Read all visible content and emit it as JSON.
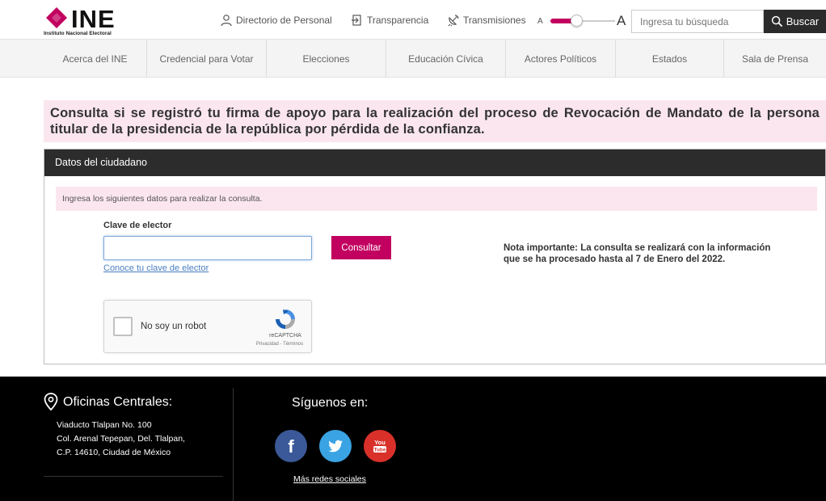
{
  "header": {
    "logo_word": "INE",
    "logo_sub": "Instituto Nacional Electoral",
    "links": [
      {
        "label": "Directorio de Personal",
        "icon": "user-icon"
      },
      {
        "label": "Transparencia",
        "icon": "transparency-icon"
      },
      {
        "label": "Transmisiones",
        "icon": "satellite-icon"
      }
    ],
    "font_size": {
      "small": "A",
      "large": "A",
      "level": 0.4
    },
    "search": {
      "placeholder": "Ingresa tu búsqueda",
      "button": "Buscar"
    }
  },
  "nav": {
    "items": [
      "Acerca del INE",
      "Credencial para Votar",
      "Elecciones",
      "Educación Cívica",
      "Actores Políticos",
      "Estados",
      "Sala de Prensa"
    ]
  },
  "main": {
    "title": "Consulta si se registró tu firma de apoyo para la realización del proceso de Revocación de Mandato de la persona titular de la presidencia de la república por pérdida de la confianza.",
    "panel_title": "Datos del ciudadano",
    "notice": "Ingresa los siguientes datos para realizar la consulta.",
    "field_label": "Clave de elector",
    "field_value": "",
    "submit": "Consultar",
    "help_link": "Conoce tu clave de elector",
    "note": "Nota importante: La consulta se realizará con la información que se ha procesado hasta al 7 de Enero del 2022.",
    "captcha": {
      "label": "No soy un robot",
      "brand": "reCAPTCHA",
      "links": "Privacidad - Términos"
    }
  },
  "footer": {
    "offices_title": "Oficinas Centrales:",
    "address": [
      "Viaducto Tlalpan No. 100",
      "Col. Arenal Tepepan, Del. Tlalpan,",
      "C.P. 14610, Ciudad de México"
    ],
    "follow_title": "Síguenos en:",
    "social": [
      {
        "name": "facebook-icon",
        "glyph": "f"
      },
      {
        "name": "twitter-icon",
        "glyph": ""
      },
      {
        "name": "youtube-icon",
        "glyph": "You Tube"
      }
    ],
    "more_social": "Más redes sociales"
  },
  "colors": {
    "accent": "#c2005f",
    "pink_bg": "#fbe6ef",
    "dark": "#2c2c2c",
    "footer": "#000000"
  }
}
